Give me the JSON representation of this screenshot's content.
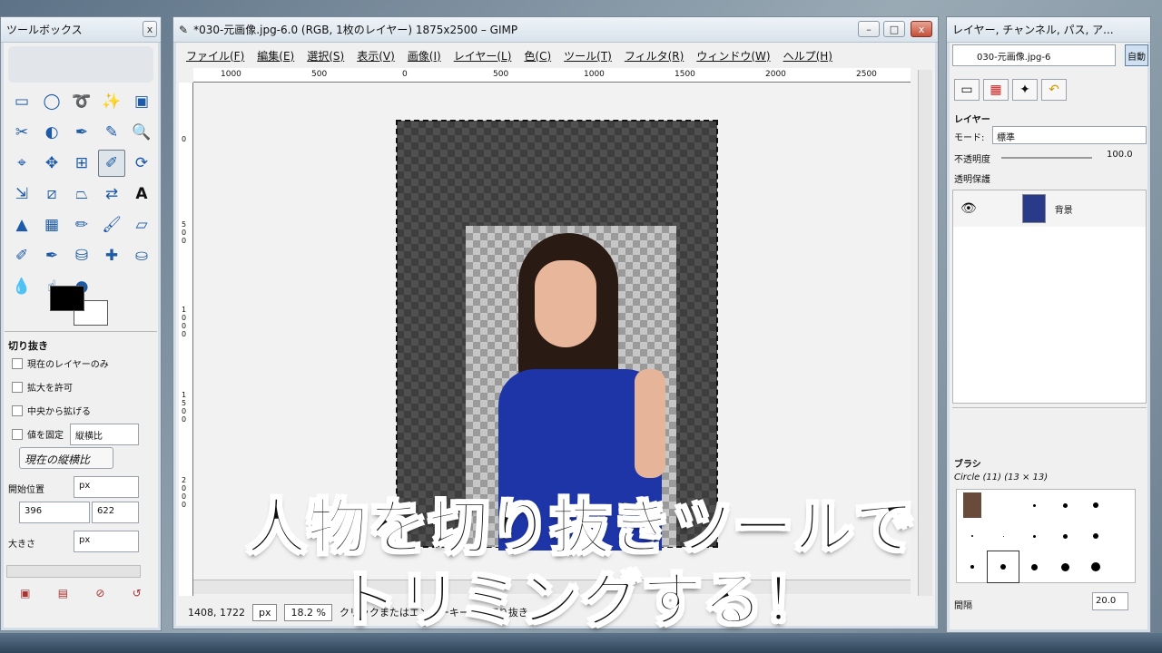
{
  "toolbox": {
    "title": "ツールボックス",
    "close": "x",
    "options_title": "切り抜き",
    "options": [
      "現在のレイヤーのみ",
      "拡大を許可",
      "中央から拡げる",
      "値を固定"
    ],
    "fixed_value": "縦横比",
    "aspect_current": "現在の縦横比",
    "pos_label": "開始位置",
    "unit": "px",
    "pos_x": "396",
    "pos_y": "622",
    "size_label": "大きさ",
    "size_unit": "px"
  },
  "window": {
    "title": "*030-元画像.jpg-6.0 (RGB, 1枚のレイヤー) 1875x2500 – GIMP",
    "min": "–",
    "max": "□",
    "close": "x"
  },
  "menu": [
    "ファイル(F)",
    "編集(E)",
    "選択(S)",
    "表示(V)",
    "画像(I)",
    "レイヤー(L)",
    "色(C)",
    "ツール(T)",
    "フィルタ(R)",
    "ウィンドウ(W)",
    "ヘルプ(H)"
  ],
  "ruler_labels": [
    "1000",
    "500",
    "0",
    "500",
    "1000",
    "1500",
    "2000",
    "2500"
  ],
  "ruler_v_labels": [
    "0",
    "500",
    "1000",
    "1500",
    "2000"
  ],
  "status": {
    "coords": "1408, 1722",
    "unit": "px",
    "zoom": "18.2 %",
    "message": "クリックまたはエンターキーで、切り抜き"
  },
  "panel": {
    "title": "レイヤー, チャンネル, パス, ア...",
    "image": "030-元画像.jpg-6",
    "auto": "自動",
    "layers_label": "レイヤー",
    "mode_label": "モード:",
    "mode_value": "標準",
    "opacity_label": "不透明度",
    "opacity_value": "100.0",
    "lock_label": "透明保護",
    "layer_name": "背景",
    "brush_label": "ブラシ",
    "brush_name": "Circle (11) (13 × 13)",
    "spacing_label": "間隔",
    "spacing_value": "20.0"
  },
  "caption": {
    "line1": "人物を切り抜きツールで",
    "line2": "トリミングする！"
  },
  "colors": {
    "accent": "#1d5aa7"
  },
  "icons": [
    "rect-select-icon",
    "ellipse-select-icon",
    "lasso-icon",
    "fuzzy-select-icon",
    "color-select-icon",
    "scissors-icon",
    "foreground-select-icon",
    "paths-icon",
    "color-picker-icon",
    "zoom-icon",
    "measure-icon",
    "move-icon",
    "align-icon",
    "crop-icon",
    "rotate-icon",
    "scale-icon",
    "shear-icon",
    "perspective-icon",
    "flip-icon",
    "text-icon",
    "bucket-fill-icon",
    "blend-icon",
    "pencil-icon",
    "paintbrush-icon",
    "eraser-icon",
    "airbrush-icon",
    "ink-icon",
    "clone-icon",
    "heal-icon",
    "perspective-clone-icon",
    "blur-icon",
    "smudge-icon",
    "dodge-burn-icon"
  ]
}
